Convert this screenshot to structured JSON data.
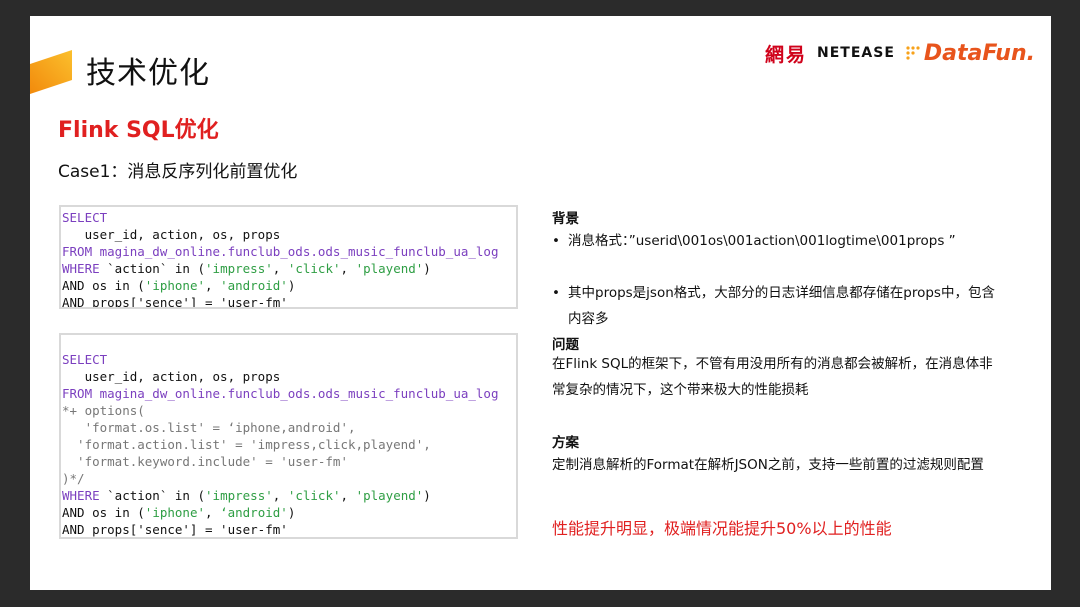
{
  "header": {
    "title": "技术优化",
    "logo_netease_cn": "網易",
    "logo_netease_en": "NETEASE",
    "logo_datafun": "DataFun."
  },
  "section": {
    "title": "Flink SQL优化",
    "case_title": "Case1：消息反序列化前置优化"
  },
  "code1": [
    [
      {
        "t": "SELECT",
        "c": "kw"
      }
    ],
    [
      {
        "t": "   user_id, action, os, props",
        "c": ""
      }
    ],
    [
      {
        "t": "FROM magina_dw_online.funclub_ods.ods_music_funclub_ua_log",
        "c": "kw"
      }
    ],
    [
      {
        "t": "WHERE ",
        "c": "kw"
      },
      {
        "t": "`action`",
        "c": ""
      },
      {
        "t": " in (",
        "c": ""
      },
      {
        "t": "'impress'",
        "c": "str"
      },
      {
        "t": ", ",
        "c": ""
      },
      {
        "t": "'click'",
        "c": "str"
      },
      {
        "t": ", ",
        "c": ""
      },
      {
        "t": "'playend'",
        "c": "str"
      },
      {
        "t": ")",
        "c": ""
      }
    ],
    [
      {
        "t": "AND os in (",
        "c": ""
      },
      {
        "t": "'iphone'",
        "c": "str"
      },
      {
        "t": ", ",
        "c": ""
      },
      {
        "t": "'android'",
        "c": "str"
      },
      {
        "t": ")",
        "c": ""
      }
    ],
    [
      {
        "t": "AND props['sence'] = 'user-fm'",
        "c": ""
      }
    ]
  ],
  "code2": [
    [
      {
        "t": "SELECT",
        "c": "kw"
      }
    ],
    [
      {
        "t": "   user_id, action, os, props",
        "c": ""
      }
    ],
    [
      {
        "t": "FROM magina_dw_online.funclub_ods.ods_music_funclub_ua_log",
        "c": "kw"
      }
    ],
    [
      {
        "t": "*+ options(",
        "c": "cm"
      }
    ],
    [
      {
        "t": "   'format.os.list' = ‘iphone,android',",
        "c": "cm"
      }
    ],
    [
      {
        "t": "  'format.action.list' = 'impress,click,playend',",
        "c": "cm"
      }
    ],
    [
      {
        "t": "  'format.keyword.include' = 'user-fm'",
        "c": "cm"
      }
    ],
    [
      {
        "t": ")*/",
        "c": "cm"
      }
    ],
    [
      {
        "t": "WHERE ",
        "c": "kw"
      },
      {
        "t": "`action`",
        "c": ""
      },
      {
        "t": " in (",
        "c": ""
      },
      {
        "t": "'impress'",
        "c": "str"
      },
      {
        "t": ", ",
        "c": ""
      },
      {
        "t": "'click'",
        "c": "str"
      },
      {
        "t": ", ",
        "c": ""
      },
      {
        "t": "'playend'",
        "c": "str"
      },
      {
        "t": ")",
        "c": ""
      }
    ],
    [
      {
        "t": "AND os in (",
        "c": ""
      },
      {
        "t": "'iphone'",
        "c": "str"
      },
      {
        "t": ", ",
        "c": ""
      },
      {
        "t": "‘android'",
        "c": "str"
      },
      {
        "t": ")",
        "c": ""
      }
    ],
    [
      {
        "t": "AND props['sence'] = 'user-fm'",
        "c": ""
      }
    ]
  ],
  "background": {
    "heading": "背景",
    "bullet1": "消息格式：”userid\\001os\\001action\\001logtime\\001props ”",
    "bullet2": "其中props是json格式，大部分的日志详细信息都存储在props中，包含内容多"
  },
  "problem": {
    "heading": "问题",
    "text": "在Flink SQL的框架下，不管有用没用所有的消息都会被解析，在消息体非常复杂的情况下，这个带来极大的性能损耗"
  },
  "solution": {
    "heading": "方案",
    "text": "定制消息解析的Format在解析JSON之前，支持一些前置的过滤规则配置"
  },
  "result": {
    "text": "性能提升明显，极端情况能提升50%以上的性能"
  },
  "colors": {
    "accent_red": "#e02020",
    "keyword_purple": "#7b3fbf",
    "string_green": "#2f9e44",
    "accent_orange": "#f7a21b"
  }
}
